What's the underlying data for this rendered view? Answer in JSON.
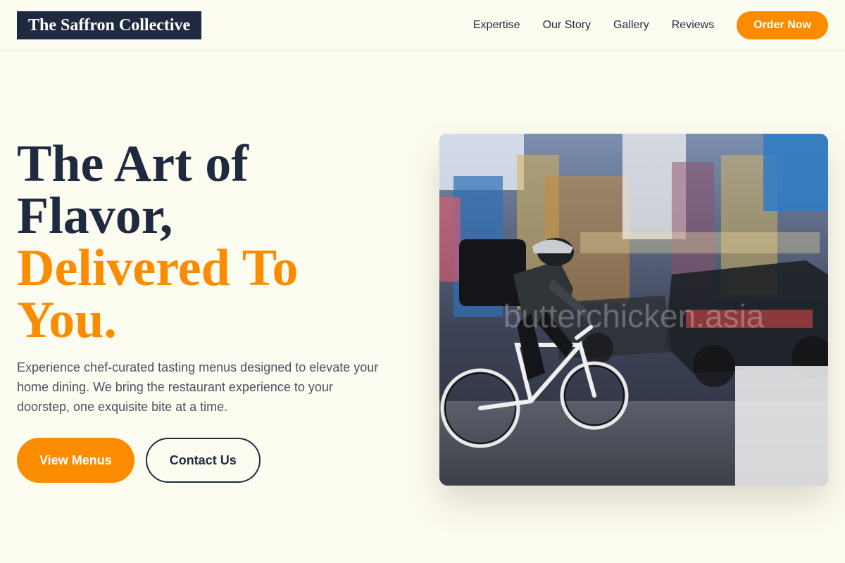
{
  "header": {
    "logo": "The Saffron Collective",
    "nav": [
      "Expertise",
      "Our Story",
      "Gallery",
      "Reviews"
    ],
    "order_label": "Order Now"
  },
  "hero": {
    "title_line1": "The Art of",
    "title_line2": "Flavor,",
    "title_accent1": "Delivered To",
    "title_accent2": "You.",
    "description": "Experience chef-curated tasting menus designed to elevate your home dining. We bring the restaurant experience to your doorstep, one exquisite bite at a time.",
    "primary_cta": "View Menus",
    "secondary_cta": "Contact Us",
    "image_watermark": "butterchicken.asia"
  },
  "colors": {
    "background": "#fdfcf0",
    "navy": "#1f2a40",
    "accent": "#fb8c00"
  }
}
